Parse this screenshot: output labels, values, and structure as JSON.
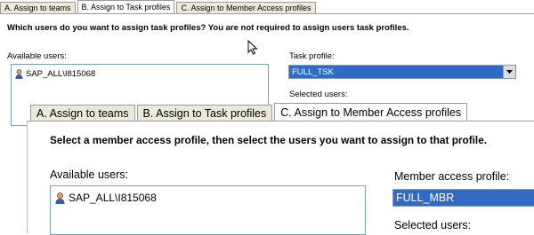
{
  "back_window": {
    "tabs": [
      {
        "label": "A. Assign to teams"
      },
      {
        "label": "B. Assign to Task profiles"
      },
      {
        "label": "C. Assign to Member Access profiles"
      }
    ],
    "instruction": "Which users do you want to assign task profiles? You are not required to assign users task profiles.",
    "available_users_label": "Available users:",
    "available_users": [
      "SAP_ALL\\I815068"
    ],
    "task_profile_label": "Task profile:",
    "task_profile_value": "FULL_TSK",
    "selected_users_label": "Selected users:"
  },
  "front_window": {
    "tabs": [
      {
        "label": "A. Assign to teams"
      },
      {
        "label": "B. Assign to Task profiles"
      },
      {
        "label": "C. Assign to Member Access profiles"
      }
    ],
    "instruction": "Select a member access profile, then select the users you want to assign to that profile.",
    "available_users_label": "Available users:",
    "available_users": [
      "SAP_ALL\\I815068"
    ],
    "member_access_profile_label": "Member access profile:",
    "member_access_profile_value": "FULL_MBR",
    "selected_users_label": "Selected users:"
  },
  "icons": {
    "user": "user-icon",
    "dropdown": "chevron-down-icon",
    "cursor": "mouse-pointer-icon"
  },
  "colors": {
    "tab_bg": "#ece9d8",
    "selection": "#316ac5",
    "list_border": "#7f9db9"
  }
}
